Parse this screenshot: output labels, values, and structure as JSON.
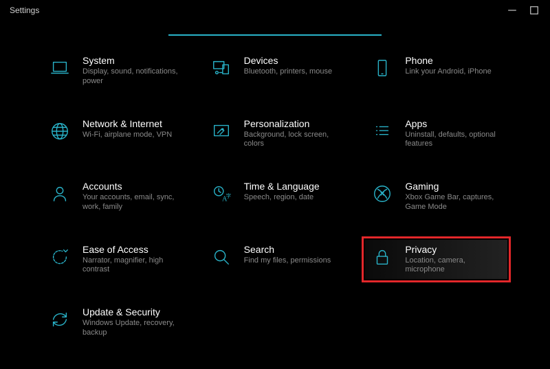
{
  "window": {
    "title": "Settings"
  },
  "search": {
    "value": ""
  },
  "tiles": {
    "system": {
      "title": "System",
      "desc": "Display, sound, notifications, power"
    },
    "devices": {
      "title": "Devices",
      "desc": "Bluetooth, printers, mouse"
    },
    "phone": {
      "title": "Phone",
      "desc": "Link your Android, iPhone"
    },
    "network": {
      "title": "Network & Internet",
      "desc": "Wi-Fi, airplane mode, VPN"
    },
    "personalization": {
      "title": "Personalization",
      "desc": "Background, lock screen, colors"
    },
    "apps": {
      "title": "Apps",
      "desc": "Uninstall, defaults, optional features"
    },
    "accounts": {
      "title": "Accounts",
      "desc": "Your accounts, email, sync, work, family"
    },
    "time": {
      "title": "Time & Language",
      "desc": "Speech, region, date"
    },
    "gaming": {
      "title": "Gaming",
      "desc": "Xbox Game Bar, captures, Game Mode"
    },
    "ease": {
      "title": "Ease of Access",
      "desc": "Narrator, magnifier, high contrast"
    },
    "search": {
      "title": "Search",
      "desc": "Find my files, permissions"
    },
    "privacy": {
      "title": "Privacy",
      "desc": "Location, camera, microphone"
    },
    "update": {
      "title": "Update & Security",
      "desc": "Windows Update, recovery, backup"
    }
  },
  "colors": {
    "accent": "#29b3c9",
    "highlight": "#e3272a"
  }
}
